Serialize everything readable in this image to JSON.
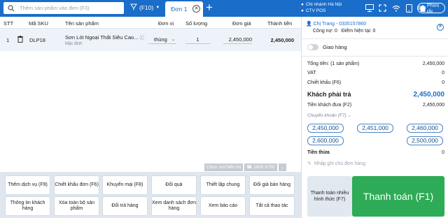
{
  "colors": {
    "topbar": "#1a6dc8",
    "accent": "#1a6dc8",
    "pay_green": "#2eab57",
    "action_bg": "#dfe6ee"
  },
  "topbar": {
    "search_placeholder": "Thêm sản phẩm vào đơn (F3)",
    "barcode_shortcut": "(F10)",
    "tab_label": "Đơn 1",
    "branch": "Chi nhánh Hà Nội",
    "pos": "CTV POS",
    "hotkey_label": "Phím tắt",
    "icons": [
      "search-icon",
      "barcode-icon",
      "close-icon",
      "plus-icon",
      "location-icon",
      "user-icon",
      "monitor-icon",
      "expand-icon",
      "wifi-icon",
      "tablet-icon",
      "home-icon",
      "keyboard-icon"
    ]
  },
  "table": {
    "headers": {
      "stt": "STT",
      "sku": "Mã SKU",
      "name": "Tên sản phẩm",
      "unit": "Đơn vị",
      "qty": "Số lượng",
      "price": "Đơn giá",
      "total": "Thành tiền"
    },
    "rows": [
      {
        "stt": "1",
        "sku": "DLP18",
        "name": "Sơn Lót Ngoại Thất Siêu Cao...",
        "sub": "Mặc định",
        "unit": "thùng",
        "qty": "1",
        "price": "2,450,000",
        "total": "2,450,000"
      }
    ]
  },
  "hints": {
    "show_buttons": "Chọn nút hiển thị",
    "hotline": "1900 6750"
  },
  "actions": {
    "add_service": "Thêm dịch vụ (F9)",
    "order_discount": "Chiết khấu đơn (F6)",
    "promotion": "Khuyến mại (F8)",
    "gift": "Đổi quà",
    "settings": "Thiết lập chung",
    "price_change": "Đổi giá bán hàng",
    "customer_info": "Thông tin khách hàng",
    "clear_all": "Xóa toàn bộ sản phẩm",
    "return": "Đổi trả hàng",
    "view_orders": "Xem danh sách đơn hàng",
    "view_report": "Xem báo cáo",
    "all_actions": "Tất cả thao tác"
  },
  "customer": {
    "name_phone": "Chị Trang - 0335157860",
    "debt": "Công nợ: 0",
    "points": "Điểm hiện tại: 0"
  },
  "summary": {
    "delivery": "Giao hàng",
    "total_label": "Tổng tiền: (1 sản phẩm)",
    "total_value": "2,450,000",
    "vat_label": "VAT",
    "vat_value": "0",
    "discount_label": "Chiết khấu (F6)",
    "discount_value": "0",
    "payable_label": "Khách phải trả",
    "payable_value": "2,450,000",
    "paid_label": "Tiền khách đưa (F2)",
    "paid_value": "2,450,000",
    "method": "Chuyển khoản (F7)",
    "quick_amounts": [
      "2,450,000",
      "2,451,000",
      "2,460,000",
      "2,600,000",
      "2,500,000"
    ],
    "change_label": "Tiền thừa",
    "change_value": "0",
    "note_placeholder": "Nhập ghi chú đơn hàng"
  },
  "payment": {
    "multi": "Thanh toán nhiều hình thức (F7)",
    "main": "Thanh toán (F1)"
  }
}
